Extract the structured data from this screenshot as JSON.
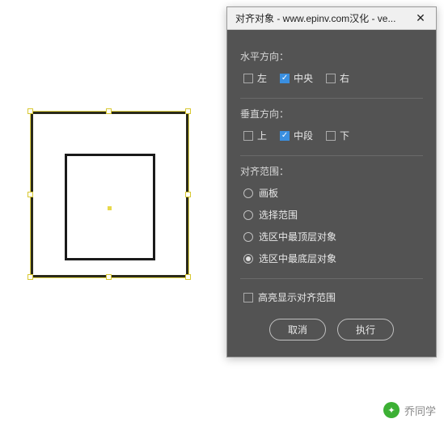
{
  "dialog": {
    "title": "对齐对象 - www.epinv.com汉化 - ve...",
    "horiz": {
      "label": "水平方向：",
      "left": "左",
      "center": "中央",
      "right": "右"
    },
    "vert": {
      "label": "垂直方向：",
      "top": "上",
      "middle": "中段",
      "bottom": "下"
    },
    "scope": {
      "label": "对齐范围：",
      "artboard": "画板",
      "selection": "选择范围",
      "topmost": "选区中最顶层对象",
      "bottommost": "选区中最底层对象"
    },
    "highlight": "高亮显示对齐范围",
    "cancel": "取消",
    "execute": "执行"
  },
  "watermark": "乔同学"
}
